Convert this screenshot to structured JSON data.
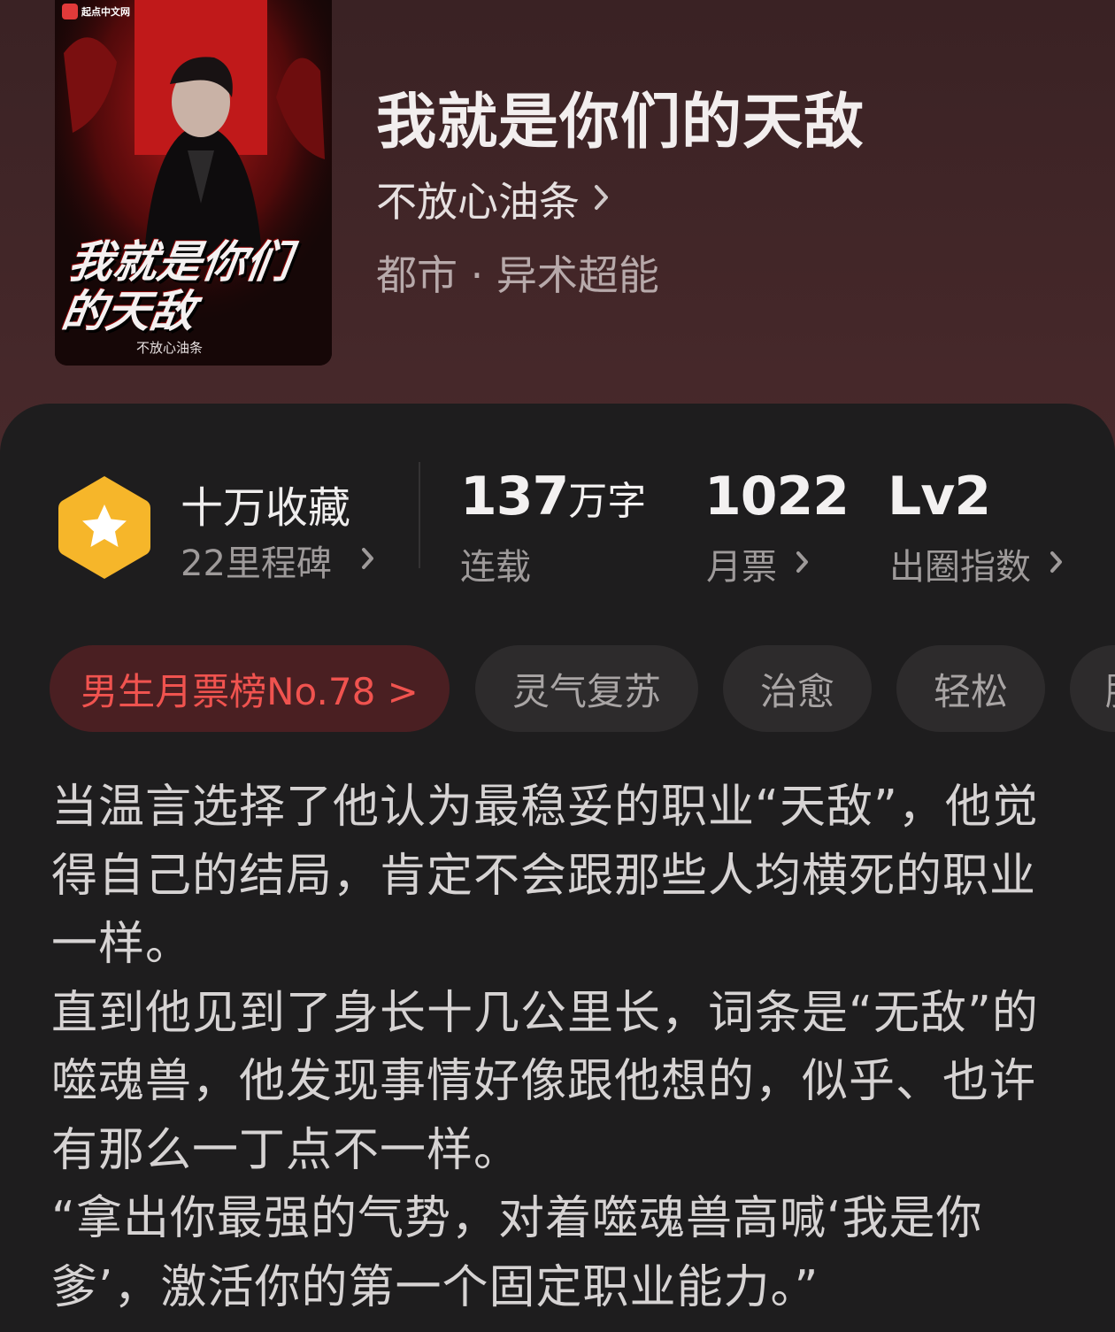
{
  "book": {
    "title": "我就是你们的天敌",
    "author": "不放心油条",
    "genre": "都市 · 异术超能",
    "cover": {
      "publisher_logo": "起点中文网",
      "title_art": "我就是你们的天敌",
      "author_art": "不放心油条"
    }
  },
  "stats": {
    "favorites": {
      "label": "十万收藏",
      "sub": "22里程碑",
      "icon": "star-hexagon-icon"
    },
    "words": {
      "value": "137",
      "unit": "万字",
      "status": "连载"
    },
    "monthly_votes": {
      "value": "1022",
      "label": "月票"
    },
    "breakout": {
      "value": "Lv2",
      "label": "出圈指数"
    }
  },
  "tags": {
    "rank": "男生月票榜No.78 >",
    "items": [
      "灵气复苏",
      "治愈",
      "轻松",
      "脑洞"
    ]
  },
  "synopsis": {
    "paragraphs": [
      "当温言选择了他认为最稳妥的职业“天敌”，他觉得自己的结局，肯定不会跟那些人均横死的职业一样。",
      "直到他见到了身长十几公里长，词条是“无敌”的噬魂兽，他发现事情好像跟他想的，似乎、也许有那么一丁点不一样。",
      "“拿出你最强的气势，对着噬魂兽高喊‘我是你爹’，激活你的第一个固定职业能力。”"
    ]
  },
  "colors": {
    "accent_red": "#f0534f",
    "badge_gold": "#f6b62a",
    "card_bg": "#1e1d1e"
  }
}
